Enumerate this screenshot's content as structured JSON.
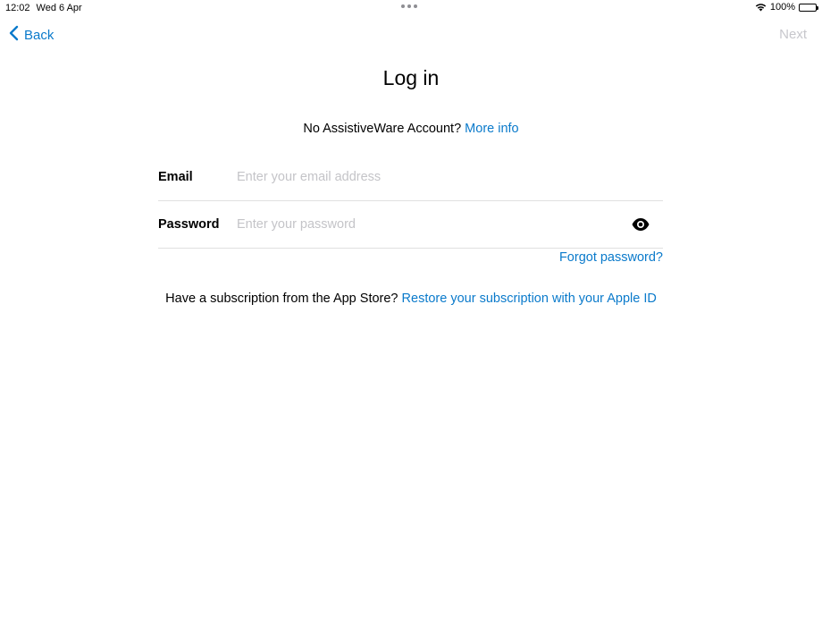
{
  "status_bar": {
    "time": "12:02",
    "date": "Wed 6 Apr",
    "battery": "100%",
    "wifi_icon": "wifi-icon",
    "battery_icon": "battery-icon"
  },
  "nav": {
    "back_label": "Back",
    "next_label": "Next",
    "back_icon": "chevron-left-icon",
    "accent_color": "#0a7acb",
    "disabled_color": "#c7c7cc"
  },
  "title": "Log in",
  "account": {
    "prompt": "No AssistiveWare Account?",
    "more_info": "More info"
  },
  "form": {
    "email_label": "Email",
    "email_placeholder": "Enter your email address",
    "email_value": "",
    "password_label": "Password",
    "password_placeholder": "Enter your password",
    "password_value": "",
    "show_password_icon": "eye-icon",
    "forgot_password": "Forgot password?"
  },
  "subscription": {
    "prompt": "Have a subscription from the App Store?",
    "restore_link": "Restore your subscription with your Apple ID"
  }
}
